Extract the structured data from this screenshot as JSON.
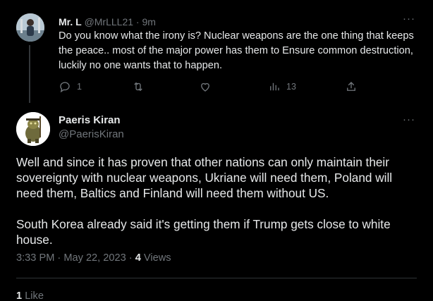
{
  "reply": {
    "name": "Mr. L",
    "handle": "@MrLLL21",
    "time": "9m",
    "text": "Do you know what the irony is? Nuclear weapons are the one thing that keeps the peace.. most of the major power has them to Ensure common destruction, luckily no one wants that to happen.",
    "actions": {
      "reply_icon": "reply-icon",
      "reply_count": "1",
      "retweet_icon": "retweet-icon",
      "like_icon": "heart-icon",
      "views_icon": "views-icon",
      "views_count": "13",
      "share_icon": "share-icon"
    }
  },
  "tweet": {
    "name": "Paeris Kiran",
    "handle": "@PaerisKiran",
    "paragraph1": "Well and since it has proven that other nations can only maintain their sovereignty with nuclear weapons, Ukriane will need them, Poland will need them, Baltics and Finland will need them without US.",
    "paragraph2": "South Korea already said it's getting them if Trump gets close to white house.",
    "timestamp": "3:33 PM · May 22, 2023 ·",
    "views_count": "4",
    "views_label": "Views",
    "likes_count": "1",
    "likes_label": "Like"
  },
  "more_icon": "more-icon",
  "colors": {
    "background": "#000000",
    "text_primary": "#e7e9ea",
    "text_secondary": "#71767b",
    "divider": "#2f3336"
  }
}
